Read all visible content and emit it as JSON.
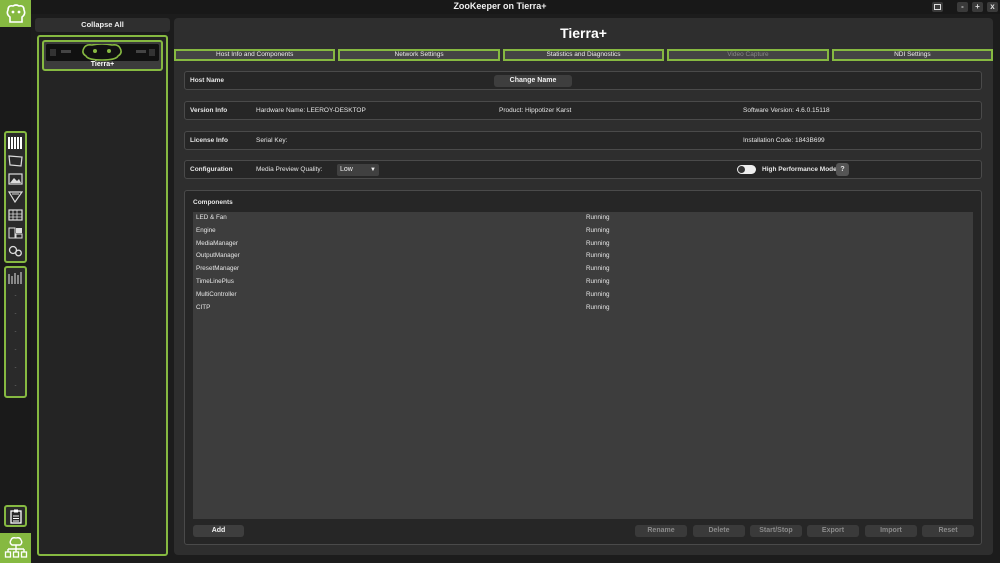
{
  "window": {
    "title": "ZooKeeper on Tierra+",
    "buttons": [
      "-",
      "+",
      "x"
    ]
  },
  "rail": {
    "top_icons": [
      "bars-icon",
      "screen-icon",
      "media-icon",
      "projector-icon",
      "grid-icon",
      "layout-icon",
      "gears-icon"
    ],
    "empty_slot": "-",
    "empty_slot_count": 6
  },
  "side_panel": {
    "collapse_label": "Collapse All",
    "devices": [
      {
        "name": "Tierra+"
      }
    ]
  },
  "host": {
    "title": "Tierra+"
  },
  "tabs": [
    {
      "label": "Host Info and Components",
      "enabled": true
    },
    {
      "label": "Network Settings",
      "enabled": true
    },
    {
      "label": "Statistics and Diagnostics",
      "enabled": true
    },
    {
      "label": "Video Capture",
      "enabled": false
    },
    {
      "label": "NDI Settings",
      "enabled": true
    }
  ],
  "host_name": {
    "label": "Host Name",
    "change_button": "Change Name"
  },
  "version_info": {
    "label": "Version Info",
    "hardware": "Hardware Name: LEEROY-DESKTOP",
    "product": "Product: Hippotizer Karst",
    "software": "Software Version: 4.6.0.15118"
  },
  "license_info": {
    "label": "License Info",
    "serial": "Serial Key:",
    "installation": "Installation Code: 1843B699"
  },
  "configuration": {
    "label": "Configuration",
    "quality_label": "Media Preview Quality:",
    "quality_value": "Low",
    "high_perf_label": "High Performance Mode",
    "high_perf_on": false,
    "help_label": "?"
  },
  "components": {
    "title": "Components",
    "rows": [
      {
        "name": "LED & Fan",
        "status": "Running"
      },
      {
        "name": "Engine",
        "status": "Running"
      },
      {
        "name": "MediaManager",
        "status": "Running"
      },
      {
        "name": "OutputManager",
        "status": "Running"
      },
      {
        "name": "PresetManager",
        "status": "Running"
      },
      {
        "name": "TimeLinePlus",
        "status": "Running"
      },
      {
        "name": "MultiController",
        "status": "Running"
      },
      {
        "name": "CITP",
        "status": "Running"
      }
    ],
    "buttons": {
      "add": "Add",
      "rename": "Rename",
      "delete": "Delete",
      "start_stop": "Start/Stop",
      "export": "Export",
      "import": "Import",
      "reset": "Reset"
    }
  },
  "colors": {
    "accent": "#86b941",
    "background": "#1c1c1c",
    "panel": "#2e2e2e"
  }
}
